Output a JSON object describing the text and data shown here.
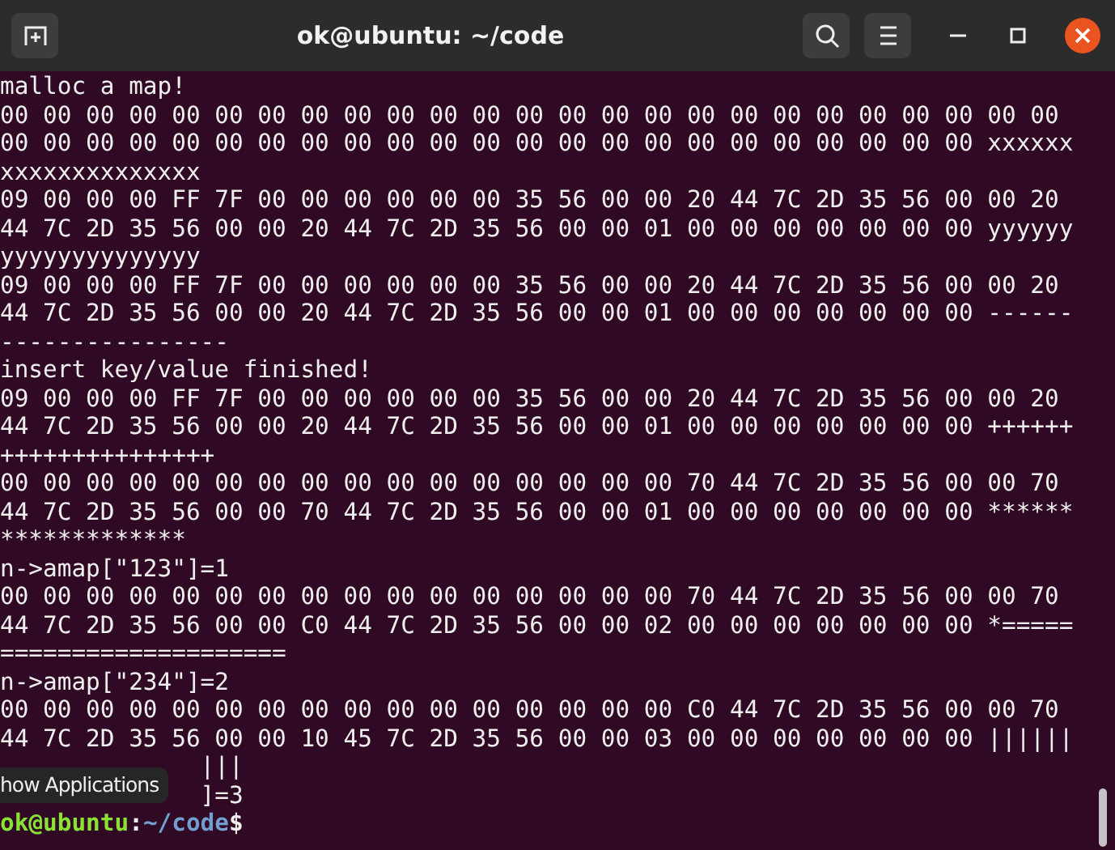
{
  "window": {
    "title": "ok@ubuntu: ~/code"
  },
  "terminal": {
    "lines": [
      {
        "kind": "text",
        "text": "malloc a map!"
      },
      {
        "kind": "text",
        "text": "00 00 00 00 00 00 00 00 00 00 00 00 00 00 00 00 00 00 00 00 00 00 00 00 00"
      },
      {
        "kind": "text",
        "text": "00 00 00 00 00 00 00 00 00 00 00 00 00 00 00 00 00 00 00 00 00 00 00 xxxxxx"
      },
      {
        "kind": "text",
        "text": "xxxxxxxxxxxxxx"
      },
      {
        "kind": "text",
        "text": "09 00 00 00 FF 7F 00 00 00 00 00 00 35 56 00 00 20 44 7C 2D 35 56 00 00 20"
      },
      {
        "kind": "text",
        "text": "44 7C 2D 35 56 00 00 20 44 7C 2D 35 56 00 00 01 00 00 00 00 00 00 00 yyyyyy"
      },
      {
        "kind": "text",
        "text": "yyyyyyyyyyyyyy"
      },
      {
        "kind": "text",
        "text": "09 00 00 00 FF 7F 00 00 00 00 00 00 35 56 00 00 20 44 7C 2D 35 56 00 00 20"
      },
      {
        "kind": "text",
        "text": "44 7C 2D 35 56 00 00 20 44 7C 2D 35 56 00 00 01 00 00 00 00 00 00 00 ------"
      },
      {
        "kind": "text",
        "text": "----------------"
      },
      {
        "kind": "text",
        "text": "insert key/value finished!"
      },
      {
        "kind": "text",
        "text": "09 00 00 00 FF 7F 00 00 00 00 00 00 35 56 00 00 20 44 7C 2D 35 56 00 00 20"
      },
      {
        "kind": "text",
        "text": "44 7C 2D 35 56 00 00 20 44 7C 2D 35 56 00 00 01 00 00 00 00 00 00 00 ++++++"
      },
      {
        "kind": "text",
        "text": "+++++++++++++++"
      },
      {
        "kind": "text",
        "text": "00 00 00 00 00 00 00 00 00 00 00 00 00 00 00 00 70 44 7C 2D 35 56 00 00 70"
      },
      {
        "kind": "text",
        "text": "44 7C 2D 35 56 00 00 70 44 7C 2D 35 56 00 00 01 00 00 00 00 00 00 00 ******"
      },
      {
        "kind": "text",
        "text": "*************"
      },
      {
        "kind": "text",
        "text": "n->amap[\"123\"]=1"
      },
      {
        "kind": "text",
        "text": "00 00 00 00 00 00 00 00 00 00 00 00 00 00 00 00 70 44 7C 2D 35 56 00 00 70"
      },
      {
        "kind": "text",
        "text": "44 7C 2D 35 56 00 00 C0 44 7C 2D 35 56 00 00 02 00 00 00 00 00 00 00 *====="
      },
      {
        "kind": "text",
        "text": "===================="
      },
      {
        "kind": "text",
        "text": "n->amap[\"234\"]=2"
      },
      {
        "kind": "text",
        "text": "00 00 00 00 00 00 00 00 00 00 00 00 00 00 00 00 C0 44 7C 2D 35 56 00 00 70"
      },
      {
        "kind": "text",
        "text": "44 7C 2D 35 56 00 00 10 45 7C 2D 35 56 00 00 03 00 00 00 00 00 00 00 ||||||"
      },
      {
        "kind": "occluded",
        "text": "|||"
      },
      {
        "kind": "occluded",
        "text": "]=3"
      },
      {
        "kind": "prompt",
        "user": "ok@ubuntu",
        "separator": ":",
        "path": "~/code",
        "symbol": "$"
      }
    ]
  },
  "tooltip": {
    "text": "how Applications"
  }
}
